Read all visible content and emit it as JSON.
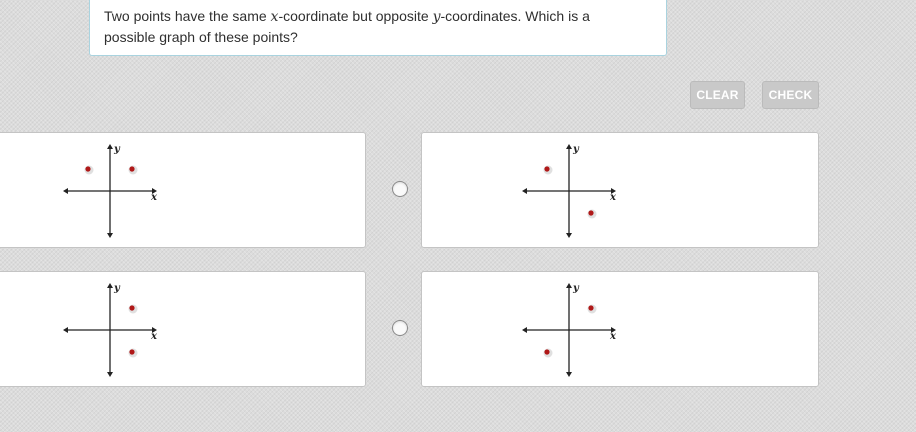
{
  "question": {
    "part1": "Two points have the same ",
    "var_x": "x",
    "part2": "-coordinate but opposite ",
    "var_y": "y",
    "part3": "-coordinates. Which is a possible graph of these points?"
  },
  "buttons": {
    "clear": "CLEAR",
    "check": "CHECK"
  },
  "colors": {
    "point": "#b01818",
    "axis": "#222222",
    "button_disabled": "#c9c9c9",
    "question_border": "#a9d3df"
  },
  "axis_labels": {
    "x": "x",
    "y": "y"
  },
  "choices": [
    {
      "id": "a",
      "points": [
        [
          -1,
          1
        ],
        [
          1,
          1
        ]
      ],
      "selected": false
    },
    {
      "id": "b",
      "points": [
        [
          -1,
          1
        ],
        [
          1,
          -1
        ]
      ],
      "selected": false
    },
    {
      "id": "c",
      "points": [
        [
          1,
          1
        ],
        [
          1,
          -1
        ]
      ],
      "selected": false
    },
    {
      "id": "d",
      "points": [
        [
          1,
          1
        ],
        [
          -1,
          -1
        ]
      ],
      "selected": false
    }
  ]
}
